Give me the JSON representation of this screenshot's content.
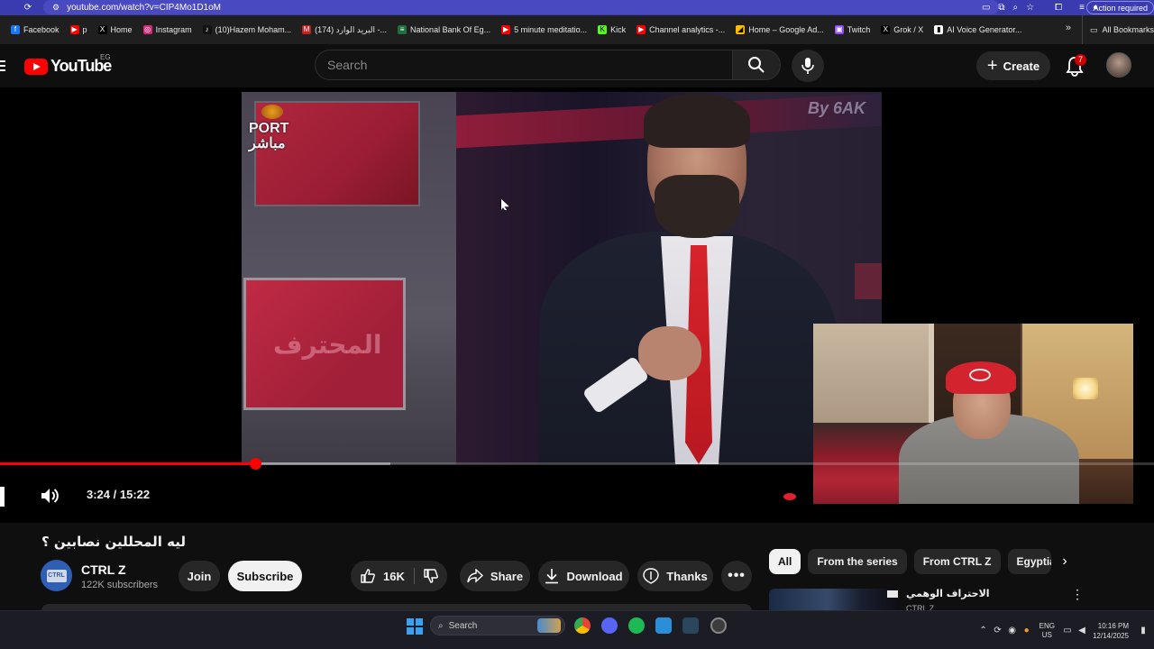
{
  "browser": {
    "url": "youtube.com/watch?v=CIP4Mo1D1oM",
    "action_required": "Action required",
    "bookmarks": [
      {
        "label": "Facebook",
        "color": "#1877f2",
        "glyph": "f"
      },
      {
        "label": "p",
        "color": "#ff0000",
        "glyph": "▶"
      },
      {
        "label": "Home",
        "color": "#000000",
        "glyph": "X"
      },
      {
        "label": "Instagram",
        "color": "#d62976",
        "glyph": "◎"
      },
      {
        "label": "(10)Hazem Moham...",
        "color": "#111111",
        "glyph": "♪"
      },
      {
        "label": "(174) البريد الوارد -...",
        "color": "#c5221f",
        "glyph": "M"
      },
      {
        "label": "National Bank Of Eg...",
        "color": "#1f6e3d",
        "glyph": "≡"
      },
      {
        "label": "5 minute meditatio...",
        "color": "#ff0000",
        "glyph": "▶"
      },
      {
        "label": "Kick",
        "color": "#53fc18",
        "glyph": "K"
      },
      {
        "label": "Channel analytics -...",
        "color": "#ff0000",
        "glyph": "▶"
      },
      {
        "label": "Home – Google Ad...",
        "color": "#fbbc04",
        "glyph": "◢"
      },
      {
        "label": "Twitch",
        "color": "#9146ff",
        "glyph": "▣"
      },
      {
        "label": "Grok / X",
        "color": "#000000",
        "glyph": "X"
      },
      {
        "label": "AI Voice Generator...",
        "color": "#ffffff",
        "glyph": "▮"
      }
    ],
    "all_bookmarks": "All Bookmarks"
  },
  "youtube": {
    "logo": "YouTube",
    "country": "EG",
    "search_placeholder": "Search",
    "create_label": "Create",
    "notification_count": "7"
  },
  "player": {
    "time": "3:24 / 15:22",
    "progress_fraction": 0.2213,
    "buffer_fraction": 0.338,
    "overlay_logo_line1": "PORT",
    "overlay_logo_line2": "مباشر",
    "overlay_watermark": "By 6AK",
    "overlay_screen_text": "المحترف"
  },
  "video": {
    "title": "ليه المحللين نصابين ؟",
    "channel_name": "CTRL Z",
    "channel_subs": "122K subscribers",
    "channel_avatar_text": "CTRL Z",
    "join_label": "Join",
    "subscribe_label": "Subscribe",
    "like_count": "16K",
    "share_label": "Share",
    "download_label": "Download",
    "thanks_label": "Thanks",
    "more_label": "•••"
  },
  "sidebar": {
    "chips": [
      "All",
      "From the series",
      "From CTRL Z",
      "Egyptia"
    ],
    "recommendation": {
      "title": "الاحتراف الوهمي",
      "channel": "CTRL Z"
    }
  },
  "taskbar": {
    "search_placeholder": "Search",
    "lang_line1": "ENG",
    "lang_line2": "US",
    "time": "10:16 PM",
    "date": "12/14/2025"
  },
  "colors": {
    "accent_red": "#ff0000",
    "browser_bar": "#3b3bb0",
    "background": "#0f0f0f"
  }
}
